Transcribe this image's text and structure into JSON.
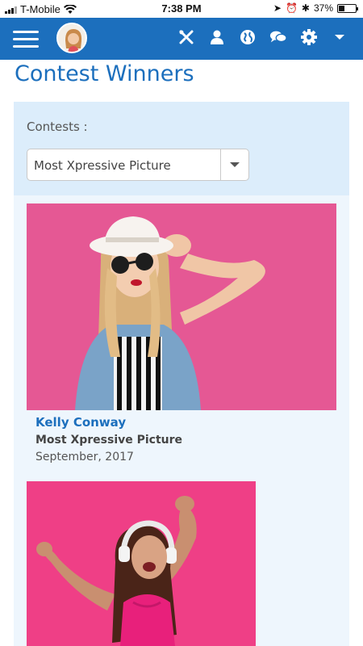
{
  "status_bar": {
    "carrier": "T-Mobile",
    "time": "7:38 PM",
    "battery": "37%",
    "battery_level": 0.37
  },
  "navbar": {
    "icons": [
      "menu-icon",
      "avatar",
      "tools-icon",
      "user-icon",
      "globe-icon",
      "chat-icon",
      "gear-icon",
      "chevron-down-icon"
    ],
    "color": "#1c6fbd"
  },
  "page": {
    "title": "Contest Winners"
  },
  "filter": {
    "label": "Contests :",
    "selected": "Most Xpressive Picture"
  },
  "winners": [
    {
      "name": "Kelly Conway",
      "contest": "Most Xpressive Picture",
      "date": "September, 2017"
    },
    {
      "name": "",
      "contest": "",
      "date": ""
    }
  ]
}
